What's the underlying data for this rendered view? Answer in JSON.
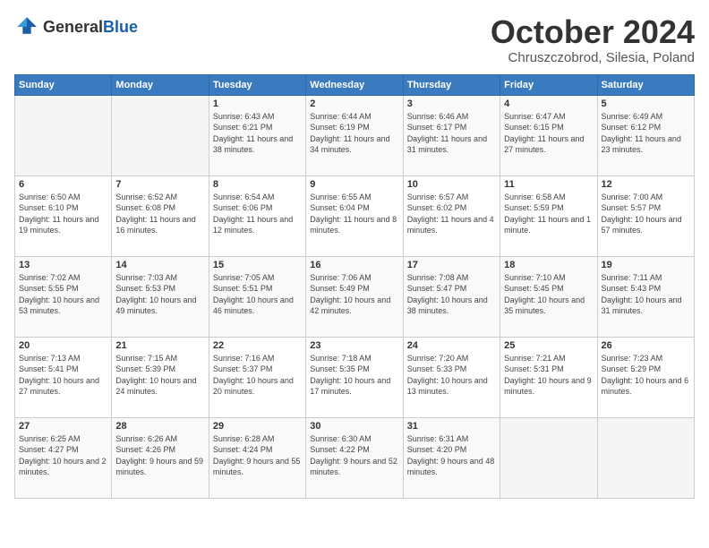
{
  "header": {
    "logo_general": "General",
    "logo_blue": "Blue",
    "month": "October 2024",
    "location": "Chruszczobrod, Silesia, Poland"
  },
  "weekdays": [
    "Sunday",
    "Monday",
    "Tuesday",
    "Wednesday",
    "Thursday",
    "Friday",
    "Saturday"
  ],
  "weeks": [
    [
      {
        "day": "",
        "empty": true
      },
      {
        "day": "",
        "empty": true
      },
      {
        "day": "1",
        "sunrise": "6:43 AM",
        "sunset": "6:21 PM",
        "daylight": "11 hours and 38 minutes."
      },
      {
        "day": "2",
        "sunrise": "6:44 AM",
        "sunset": "6:19 PM",
        "daylight": "11 hours and 34 minutes."
      },
      {
        "day": "3",
        "sunrise": "6:46 AM",
        "sunset": "6:17 PM",
        "daylight": "11 hours and 31 minutes."
      },
      {
        "day": "4",
        "sunrise": "6:47 AM",
        "sunset": "6:15 PM",
        "daylight": "11 hours and 27 minutes."
      },
      {
        "day": "5",
        "sunrise": "6:49 AM",
        "sunset": "6:12 PM",
        "daylight": "11 hours and 23 minutes."
      }
    ],
    [
      {
        "day": "6",
        "sunrise": "6:50 AM",
        "sunset": "6:10 PM",
        "daylight": "11 hours and 19 minutes."
      },
      {
        "day": "7",
        "sunrise": "6:52 AM",
        "sunset": "6:08 PM",
        "daylight": "11 hours and 16 minutes."
      },
      {
        "day": "8",
        "sunrise": "6:54 AM",
        "sunset": "6:06 PM",
        "daylight": "11 hours and 12 minutes."
      },
      {
        "day": "9",
        "sunrise": "6:55 AM",
        "sunset": "6:04 PM",
        "daylight": "11 hours and 8 minutes."
      },
      {
        "day": "10",
        "sunrise": "6:57 AM",
        "sunset": "6:02 PM",
        "daylight": "11 hours and 4 minutes."
      },
      {
        "day": "11",
        "sunrise": "6:58 AM",
        "sunset": "5:59 PM",
        "daylight": "11 hours and 1 minute."
      },
      {
        "day": "12",
        "sunrise": "7:00 AM",
        "sunset": "5:57 PM",
        "daylight": "10 hours and 57 minutes."
      }
    ],
    [
      {
        "day": "13",
        "sunrise": "7:02 AM",
        "sunset": "5:55 PM",
        "daylight": "10 hours and 53 minutes."
      },
      {
        "day": "14",
        "sunrise": "7:03 AM",
        "sunset": "5:53 PM",
        "daylight": "10 hours and 49 minutes."
      },
      {
        "day": "15",
        "sunrise": "7:05 AM",
        "sunset": "5:51 PM",
        "daylight": "10 hours and 46 minutes."
      },
      {
        "day": "16",
        "sunrise": "7:06 AM",
        "sunset": "5:49 PM",
        "daylight": "10 hours and 42 minutes."
      },
      {
        "day": "17",
        "sunrise": "7:08 AM",
        "sunset": "5:47 PM",
        "daylight": "10 hours and 38 minutes."
      },
      {
        "day": "18",
        "sunrise": "7:10 AM",
        "sunset": "5:45 PM",
        "daylight": "10 hours and 35 minutes."
      },
      {
        "day": "19",
        "sunrise": "7:11 AM",
        "sunset": "5:43 PM",
        "daylight": "10 hours and 31 minutes."
      }
    ],
    [
      {
        "day": "20",
        "sunrise": "7:13 AM",
        "sunset": "5:41 PM",
        "daylight": "10 hours and 27 minutes."
      },
      {
        "day": "21",
        "sunrise": "7:15 AM",
        "sunset": "5:39 PM",
        "daylight": "10 hours and 24 minutes."
      },
      {
        "day": "22",
        "sunrise": "7:16 AM",
        "sunset": "5:37 PM",
        "daylight": "10 hours and 20 minutes."
      },
      {
        "day": "23",
        "sunrise": "7:18 AM",
        "sunset": "5:35 PM",
        "daylight": "10 hours and 17 minutes."
      },
      {
        "day": "24",
        "sunrise": "7:20 AM",
        "sunset": "5:33 PM",
        "daylight": "10 hours and 13 minutes."
      },
      {
        "day": "25",
        "sunrise": "7:21 AM",
        "sunset": "5:31 PM",
        "daylight": "10 hours and 9 minutes."
      },
      {
        "day": "26",
        "sunrise": "7:23 AM",
        "sunset": "5:29 PM",
        "daylight": "10 hours and 6 minutes."
      }
    ],
    [
      {
        "day": "27",
        "sunrise": "6:25 AM",
        "sunset": "4:27 PM",
        "daylight": "10 hours and 2 minutes."
      },
      {
        "day": "28",
        "sunrise": "6:26 AM",
        "sunset": "4:26 PM",
        "daylight": "9 hours and 59 minutes."
      },
      {
        "day": "29",
        "sunrise": "6:28 AM",
        "sunset": "4:24 PM",
        "daylight": "9 hours and 55 minutes."
      },
      {
        "day": "30",
        "sunrise": "6:30 AM",
        "sunset": "4:22 PM",
        "daylight": "9 hours and 52 minutes."
      },
      {
        "day": "31",
        "sunrise": "6:31 AM",
        "sunset": "4:20 PM",
        "daylight": "9 hours and 48 minutes."
      },
      {
        "day": "",
        "empty": true
      },
      {
        "day": "",
        "empty": true
      }
    ]
  ]
}
